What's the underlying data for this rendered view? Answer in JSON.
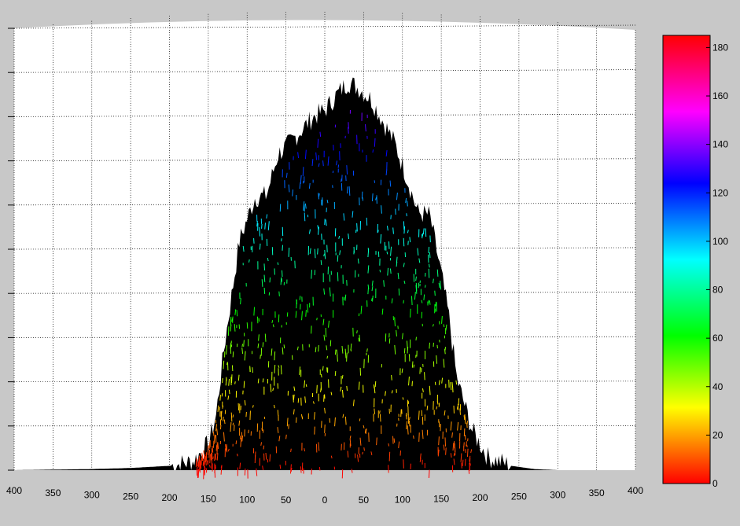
{
  "figure": {
    "background": "#c8c8c8",
    "axes_background": "#ffffff",
    "grid_color": "#000000"
  },
  "chart_data": {
    "type": "surface-3d",
    "title": "",
    "xlabel": "",
    "ylabel": "",
    "colormap": "hsv",
    "grid": true,
    "x_ticks": [
      "400",
      "350",
      "300",
      "250",
      "200",
      "150",
      "100",
      "50",
      "0",
      "50",
      "100",
      "150",
      "200",
      "250",
      "300",
      "350",
      "400"
    ],
    "colorbar": {
      "position": "right",
      "range": [
        0,
        185
      ],
      "ticks": [
        "0",
        "20",
        "40",
        "60",
        "80",
        "100",
        "120",
        "140",
        "160",
        "180"
      ]
    },
    "z_range": [
      0,
      185
    ],
    "x_range": [
      -400,
      400
    ],
    "profile": {
      "x": [
        -400,
        -300,
        -250,
        -200,
        -170,
        -150,
        -140,
        -130,
        -110,
        -90,
        -75,
        -60,
        -45,
        -30,
        -15,
        0,
        15,
        30,
        45,
        60,
        75,
        90,
        105,
        120,
        135,
        150,
        160,
        170,
        190,
        210,
        240,
        270,
        300,
        400
      ],
      "z": [
        0,
        0.5,
        1,
        2,
        4,
        12,
        25,
        55,
        105,
        125,
        126,
        145,
        150,
        156,
        162,
        165,
        172,
        178,
        175,
        170,
        160,
        150,
        135,
        118,
        117,
        90,
        70,
        42,
        18,
        6,
        2,
        0.5,
        0,
        0
      ]
    }
  }
}
